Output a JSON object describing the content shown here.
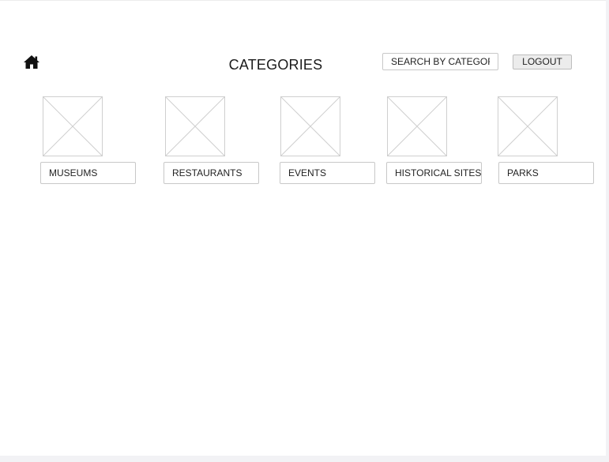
{
  "header": {
    "home_icon": "home-icon",
    "title": "CATEGORIES",
    "search": {
      "placeholder": "SEARCH BY CATEGORY",
      "value": ""
    },
    "logout_label": "LOGOUT"
  },
  "categories": [
    {
      "label": "MUSEUMS",
      "image_icon": "image-placeholder-icon"
    },
    {
      "label": "RESTAURANTS",
      "image_icon": "image-placeholder-icon"
    },
    {
      "label": "EVENTS",
      "image_icon": "image-placeholder-icon"
    },
    {
      "label": "HISTORICAL SITES",
      "image_icon": "image-placeholder-icon"
    },
    {
      "label": "PARKS",
      "image_icon": "image-placeholder-icon"
    }
  ],
  "colors": {
    "background": "#ffffff",
    "outer": "#f2f2f5",
    "border": "#c8c8c8",
    "placeholder_line": "#cfcfcf",
    "button_fill": "#ececec",
    "text": "#222222"
  }
}
